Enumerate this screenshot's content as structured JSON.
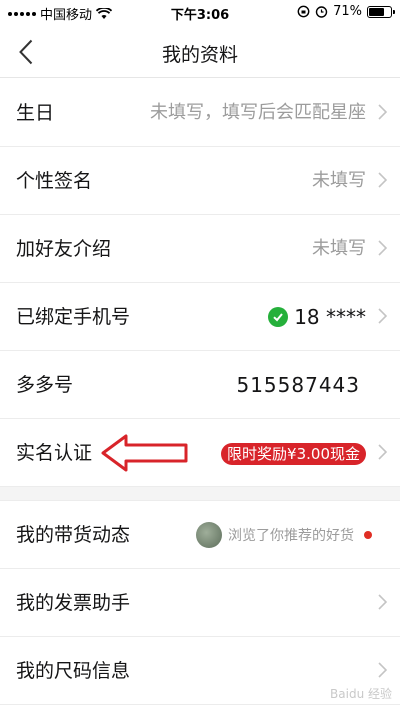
{
  "status_bar": {
    "carrier": "中国移动",
    "time": "下午3:06",
    "battery": "71%",
    "battery_level": 0.71
  },
  "nav": {
    "title": "我的资料"
  },
  "rows": {
    "birthday": {
      "label": "生日",
      "value": "未填写，填写后会匹配星座"
    },
    "signature": {
      "label": "个性签名",
      "value": "未填写"
    },
    "friend_intro": {
      "label": "加好友介绍",
      "value": "未填写"
    },
    "phone": {
      "label": "已绑定手机号",
      "value": "18 ****"
    },
    "duoduo_id": {
      "label": "多多号",
      "value": "515587443"
    },
    "real_name": {
      "label": "实名认证",
      "badge": "限时奖励¥3.00现金"
    },
    "activity": {
      "label": "我的带货动态",
      "value": "浏览了你推荐的好货"
    },
    "invoice": {
      "label": "我的发票助手"
    },
    "size_info": {
      "label": "我的尺码信息"
    }
  },
  "watermark": "Baidu 经验",
  "colors": {
    "accent_red": "#d8242a",
    "verify_green": "#25b03b",
    "text_primary": "#151516",
    "text_secondary": "#9c9c9c"
  },
  "icons": [
    "signal-icon",
    "wifi-icon",
    "alarm-icon",
    "battery-icon",
    "back-arrow-icon",
    "chevron-right-icon",
    "verified-check-icon",
    "annotation-arrow-icon",
    "unread-dot-icon"
  ]
}
